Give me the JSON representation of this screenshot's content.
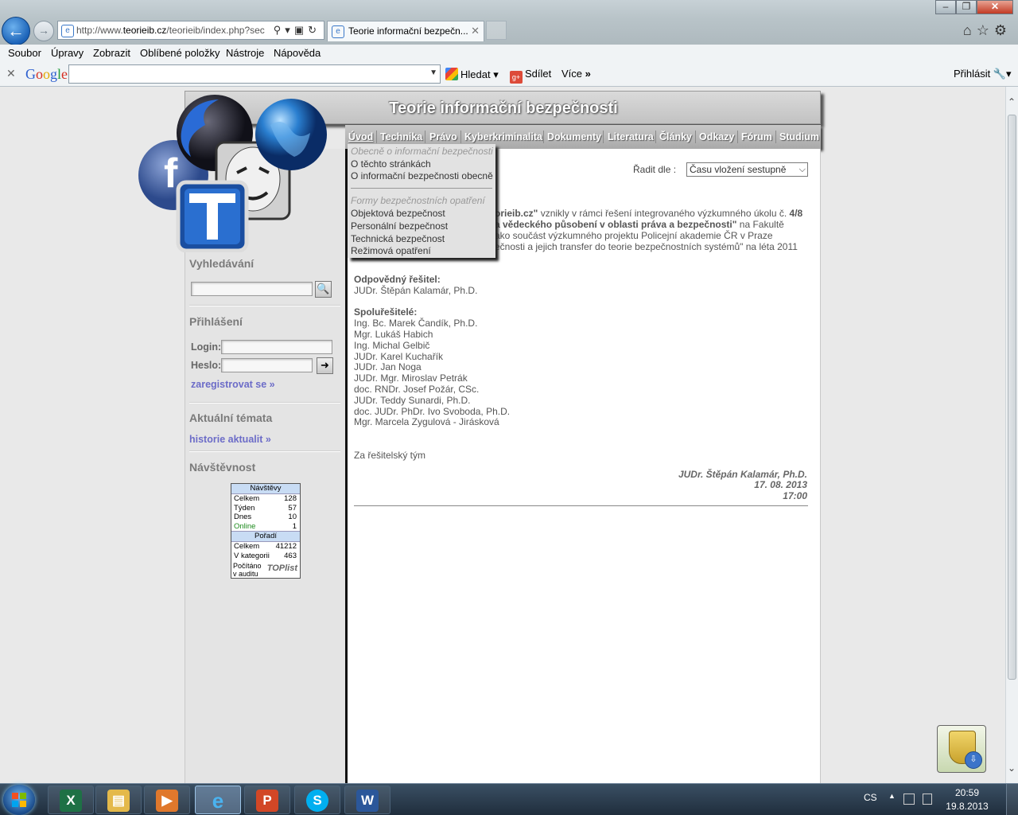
{
  "browser": {
    "url_prefix": "http://www.",
    "url_domain": "teorieib.cz",
    "url_rest": "/teorieib/index.php?sec",
    "tab_title": "Teorie informační bezpečn...",
    "menu": [
      "Soubor",
      "Úpravy",
      "Zobrazit",
      "Oblíbené položky",
      "Nástroje",
      "Nápověda"
    ],
    "google_toolbar": {
      "logo": "Google",
      "search_value": "",
      "search_button": "Hledat",
      "share_button": "Sdílet",
      "more": "Více",
      "signin": "Přihlásit"
    }
  },
  "site": {
    "title": "Teorie informační bezpečnosti",
    "nav": [
      "Úvod",
      "Technika",
      "Právo",
      "Kyberkriminalita",
      "Dokumenty",
      "Literatura",
      "Články",
      "Odkazy",
      "Fórum",
      "Studium"
    ],
    "dropdown": {
      "section1_caption": "Obecně o informační bezpečnosti",
      "section1_items": [
        "O těchto stránkách",
        "O informační bezpečnosti obecně"
      ],
      "section2_caption": "Formy bezpečnostních opatření",
      "section2_items": [
        "Objektová bezpečnost",
        "Personální bezpečnost",
        "Technická bezpečnost",
        "Režimová opatření"
      ]
    },
    "sidebar": {
      "search_heading": "Vyhledávání",
      "search_value": "",
      "login_heading": "Přihlášení",
      "login_label": "Login:",
      "password_label": "Heslo:",
      "register_link": "zaregistrovat se »",
      "topics_heading": "Aktuální témata",
      "history_link": "historie aktualit »",
      "visits_heading": "Návštěvnost",
      "counter": {
        "header1": "Návštěvy",
        "rows1": [
          {
            "label": "Celkem",
            "value": "128"
          },
          {
            "label": "Týden",
            "value": "57"
          },
          {
            "label": "Dnes",
            "value": "10"
          },
          {
            "label": "Online",
            "value": "1"
          }
        ],
        "header2": "Pořadí",
        "rows2": [
          {
            "label": "Celkem",
            "value": "41212"
          },
          {
            "label": "V kategorii",
            "value": "463"
          }
        ],
        "footer_line1": "Počítáno",
        "footer_line2": "v auditu",
        "brand": "TOPlist"
      }
    },
    "content": {
      "sort_label": "Řadit dle :",
      "sort_value": "Času vložení sestupně",
      "intro_line1_bold": "orieib.cz\"",
      "intro_line1_rest": " vznikly v rámci řešení integrovaného výzkumného úkolu č. ",
      "intro_line1_num": "4/8",
      "intro_line2_bold": "a vědeckého působení v oblasti práva a bezpečnosti\"",
      "intro_line2_rest": " na Fakultě",
      "intro_line3": "ako součást výzkumného projektu Policejní akademie ČR v Praze",
      "intro_line4": "ečnosti a jejich transfer do teorie bezpečnostních systémů\" na léta 2011",
      "responsible_heading": "Odpovědný řešitel:",
      "responsible_name": "JUDr. Štěpán Kalamár, Ph.D.",
      "coresearchers_heading": "Spoluřešitelé:",
      "coresearchers": [
        "Ing. Bc. Marek Čandík, Ph.D.",
        "Mgr. Lukáš Habich",
        "Ing. Michal Gelbič",
        "JUDr. Karel Kuchařík",
        "JUDr. Jan Noga",
        "JUDr. Mgr. Miroslav Petrák",
        "doc. RNDr. Josef Požár, CSc.",
        "JUDr. Teddy Sunardi, Ph.D.",
        "doc. JUDr. PhDr. Ivo Svoboda, Ph.D.",
        "Mgr. Marcela Zygulová - Jirásková"
      ],
      "team_line": "Za řešitelský tým",
      "signature_name": "JUDr. Štěpán Kalamár, Ph.D.",
      "signature_date": "17. 08. 2013",
      "signature_time": "17:00"
    }
  },
  "taskbar": {
    "apps": [
      "excel-icon",
      "explorer-icon",
      "media-player-icon",
      "internet-explorer-icon",
      "powerpoint-icon",
      "skype-icon",
      "word-icon"
    ],
    "lang": "CS",
    "time": "20:59",
    "date": "19.8.2013"
  }
}
